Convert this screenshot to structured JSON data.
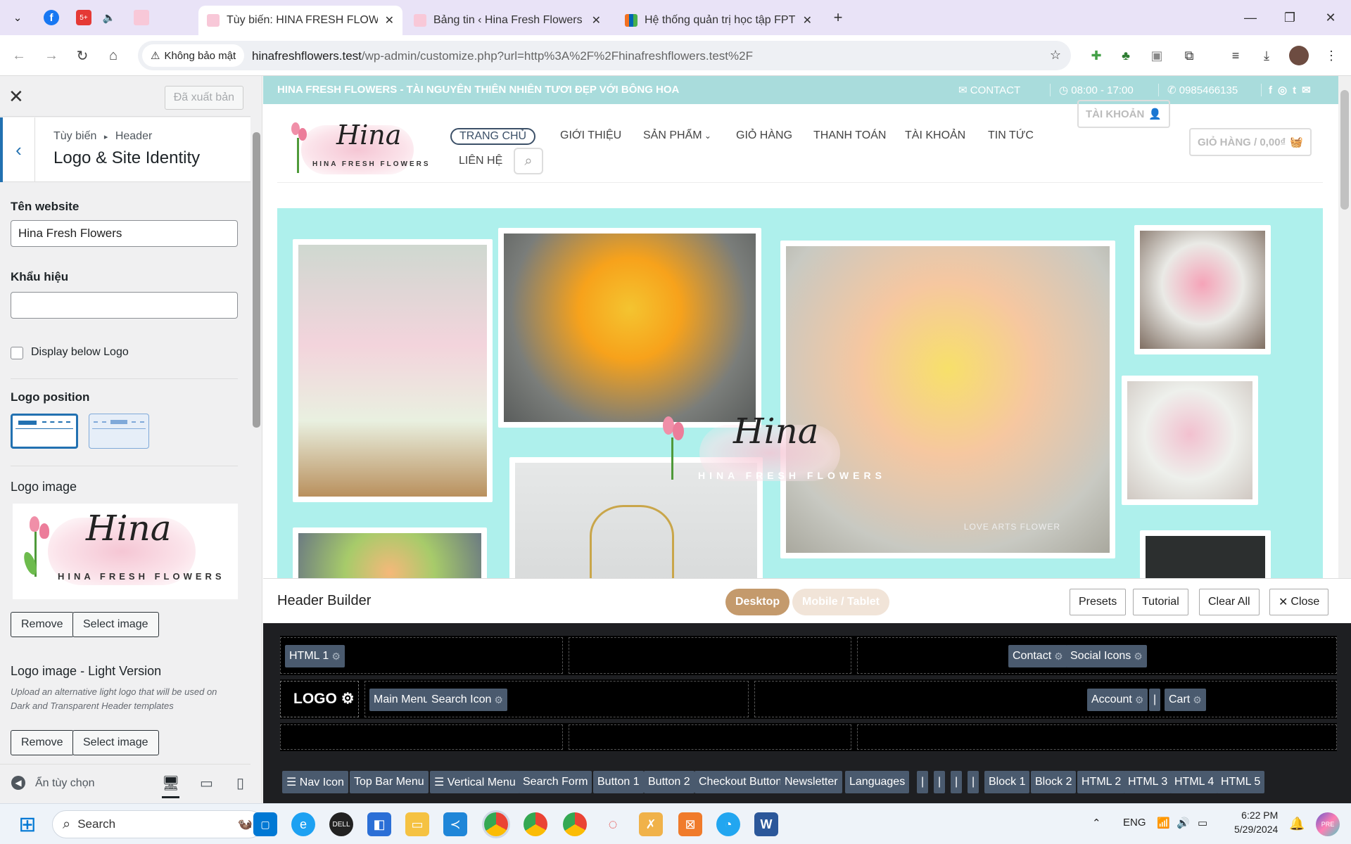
{
  "browser": {
    "tabs": [
      {
        "title": "Tùy biến: HINA FRESH FLOWERS",
        "active": true
      },
      {
        "title": "Bảng tin ‹ Hina Fresh Flowers —",
        "active": false
      },
      {
        "title": "Hệ thống quản trị học tập FPT Polytechnic",
        "active": false
      }
    ],
    "pinned_badge": "5+",
    "security_label": "Không bảo mật",
    "url_host": "hinafreshflowers.test",
    "url_path": "/wp-admin/customize.php?url=http%3A%2F%2Fhinafreshflowers.test%2F"
  },
  "sidebar": {
    "published_label": "Đã xuất bản",
    "breadcrumb_parent": "Tùy biến",
    "breadcrumb_sep": "▸",
    "breadcrumb_child": "Header",
    "section_title": "Logo & Site Identity",
    "site_title_label": "Tên website",
    "site_title_value": "Hina Fresh Flowers",
    "tagline_label": "Khẩu hiệu",
    "tagline_value": "",
    "display_below_label": "Display below Logo",
    "logo_position_label": "Logo position",
    "logo_image_label": "Logo image",
    "remove_label": "Remove",
    "select_image_label": "Select image",
    "logo_light_label": "Logo image - Light Version",
    "logo_light_desc": "Upload an alternative light logo that will be used on Dark and Transparent Header templates",
    "hide_controls_label": "Ẩn tùy chọn"
  },
  "preview": {
    "topbar_text": "HINA FRESH FLOWERS - TÀI NGUYÊN THIÊN NHIÊN TƯƠI ĐẸP VỚI BÔNG HOA",
    "contact": "CONTACT",
    "hours": "08:00 - 17:00",
    "phone": "0985466135",
    "logo_script": "Hina",
    "logo_sub": "HINA FRESH FLOWERS",
    "nav": [
      "TRANG CHỦ",
      "GIỚI THIỆU",
      "SẢN PHẨM",
      "GIỎ HÀNG",
      "THANH TOÁN",
      "TÀI KHOẢN",
      "TIN TỨC",
      "LIÊN HỆ"
    ],
    "account_btn": "TÀI KHOẢN",
    "cart_btn": "GIỎ HÀNG / 0,00₫",
    "hero_watermark": "LOVE ARTS FLOWER"
  },
  "builder": {
    "title": "Header Builder",
    "desktop": "Desktop",
    "mobile": "Mobile / Tablet",
    "presets": "Presets",
    "tutorial": "Tutorial",
    "clear_all": "Clear All",
    "close": "Close",
    "top_left": [
      "HTML 1"
    ],
    "top_right": [
      "Contact",
      "Social Icons"
    ],
    "logo": "LOGO",
    "main_left": [
      "Main Menu",
      "Search Icon"
    ],
    "main_right": [
      "Account",
      "|",
      "Cart"
    ],
    "available": [
      "☰ Nav Icon",
      "Top Bar Menu",
      "☰ Vertical Menu",
      "Search Form",
      "Button 1",
      "Button 2",
      "Checkout Button",
      "Newsletter",
      "Languages",
      "|",
      "|",
      "|",
      "|",
      "Block 1",
      "Block 2",
      "HTML 2",
      "HTML 3",
      "HTML 4",
      "HTML 5"
    ]
  },
  "taskbar": {
    "search_placeholder": "Search",
    "lang": "ENG",
    "time": "6:22 PM",
    "date": "5/29/2024"
  },
  "colors": {
    "topbar": "#a9dcdc",
    "hero_bg": "#aef0ec",
    "builder_bg": "#1e1f22",
    "chip": "#4a5a6e",
    "wp_blue": "#2271b1",
    "tab_strip": "#e9e3f7"
  }
}
